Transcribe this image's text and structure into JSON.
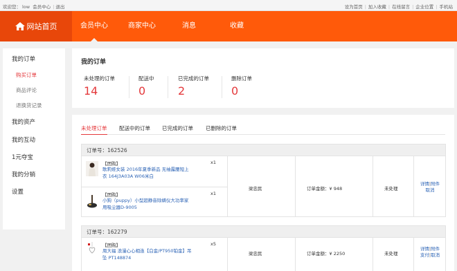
{
  "topbar": {
    "welcome": "欢迎您：",
    "user": "low",
    "member_center": "会员中心",
    "logout": "退出",
    "right_links": [
      "设为首页",
      "加入收藏",
      "在线留言",
      "企业位置",
      "手机站"
    ]
  },
  "nav": {
    "home": "网站首页",
    "items": [
      "会员中心",
      "商家中心",
      "消息",
      "收藏"
    ]
  },
  "sidebar": {
    "my_orders": "我的订单",
    "sub": [
      "购买订单",
      "商品评论",
      "退换货记录"
    ],
    "items": [
      "我的资产",
      "我的互动",
      "1元夺宝",
      "我的分销",
      "设置"
    ]
  },
  "summary": {
    "title": "我的订单",
    "stats": [
      {
        "label": "未处理的订单",
        "value": "14"
      },
      {
        "label": "配送中",
        "value": "0"
      },
      {
        "label": "已完成的订单",
        "value": "2"
      },
      {
        "label": "删除订单",
        "value": "0"
      }
    ]
  },
  "tabs": [
    "未处理订单",
    "配送中的订单",
    "已完成的订单",
    "已删除的订单"
  ],
  "orders": [
    {
      "number": "订单号：162526",
      "products": [
        {
          "tag": "【团购】",
          "title": "歌莉娅女装 2016年夏季新品 无袖露腰短上衣 164J3A03A W06米白",
          "qty": "x1"
        },
        {
          "tag": "【团购】",
          "title": "小狗（puppy）小型超静音除螨仪大功率家用吸尘器D-9005",
          "qty": "x1"
        }
      ],
      "buyer": "梁忠民",
      "amount": "订单金额：¥ 948",
      "status": "未处理",
      "actions": {
        "detail": "详情",
        "attach": "附件",
        "cancel": "取消"
      }
    },
    {
      "number": "订单号：162279",
      "products": [
        {
          "tag": "【团购】",
          "title": "周大福 浪漫心心相连【白金/PT950铂金】吊坠 PT148874",
          "qty": "x5"
        }
      ],
      "buyer": "梁忠民",
      "amount": "订单金额：¥ 2250",
      "status": "未处理",
      "actions": {
        "detail": "详情",
        "attach": "附件",
        "pay": "支付",
        "cancel": "取消"
      }
    }
  ],
  "colors": {
    "brand": "#ff5a0a",
    "home_bg": "#e8470a",
    "accent": "#e4393c",
    "link": "#2a62b5"
  }
}
